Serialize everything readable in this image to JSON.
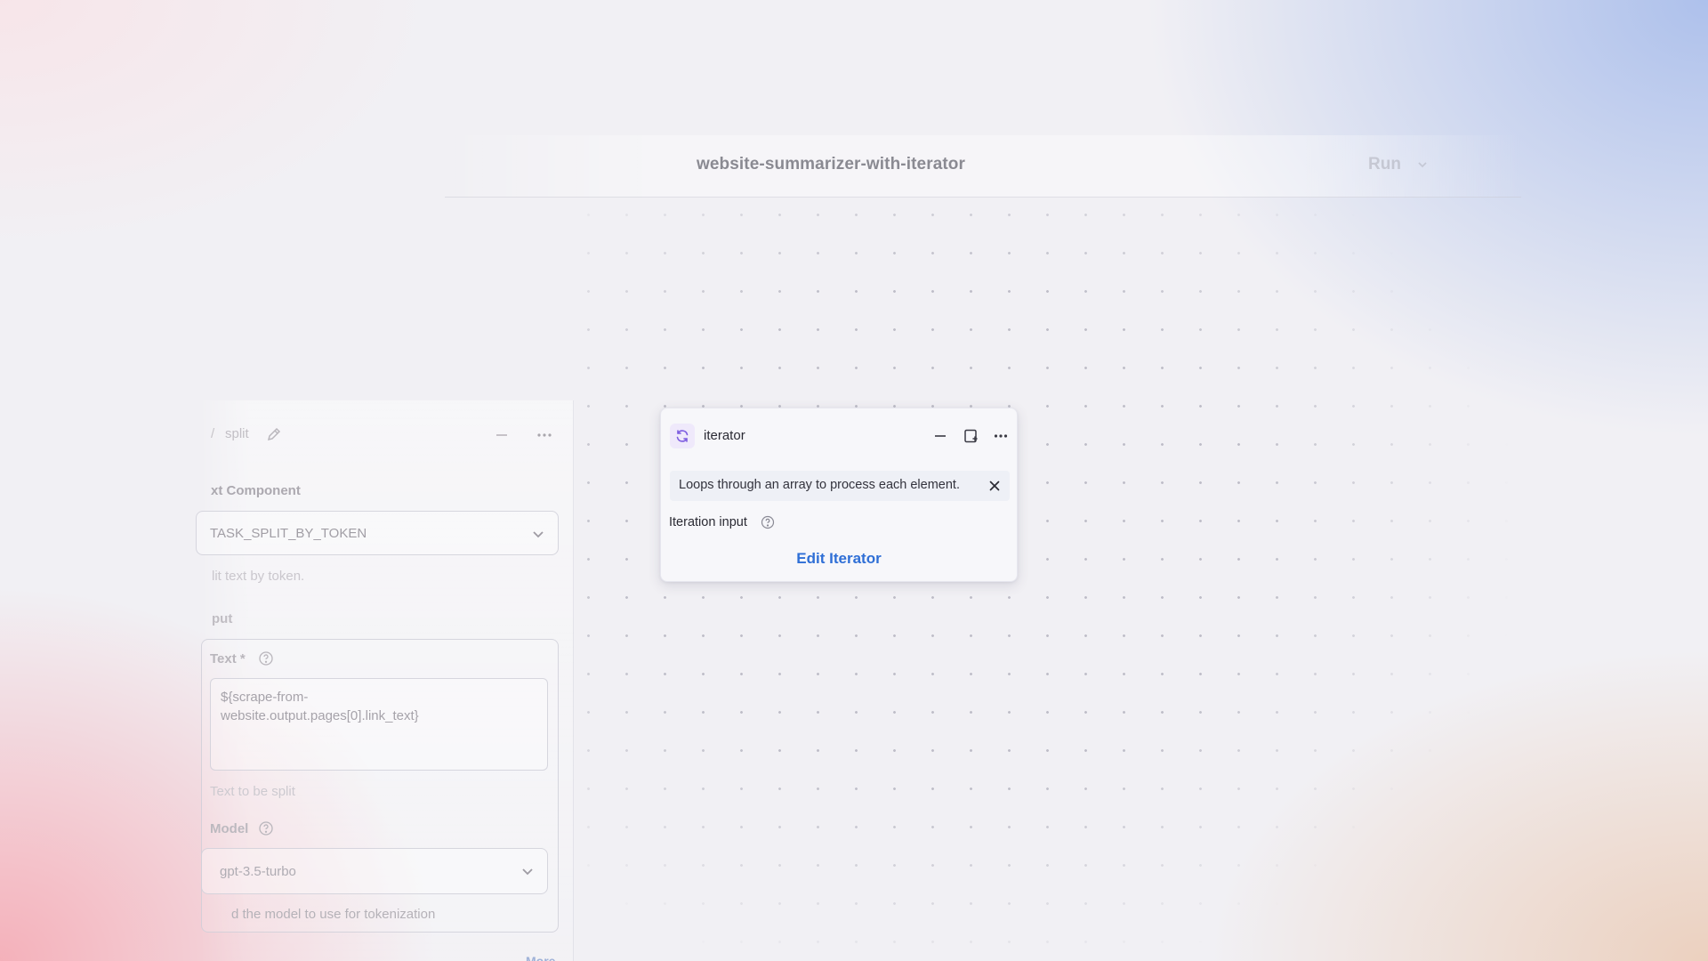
{
  "header": {
    "pipeline_title": "website-summarizer-with-iterator",
    "run_label": "Run"
  },
  "left_panel": {
    "node_title": "split",
    "component_label": "xt Component",
    "task_value": "TASK_SPLIT_BY_TOKEN",
    "task_description": "lit text by token.",
    "input_section": "put",
    "text_field_label": "Text *",
    "text_field_value": "${scrape-from-\nwebsite.output.pages[0].link_text}",
    "text_field_hint": "Text to be split",
    "model_label": "Model",
    "model_value": "gpt-3.5-turbo",
    "model_hint": "d the model to use for tokenization",
    "more_label": "More"
  },
  "iterator_node": {
    "title": "iterator",
    "info_text": "Loops through an array to process each element.",
    "iteration_input_label": "Iteration input",
    "edit_button_label": "Edit Iterator"
  },
  "colors": {
    "accent": "#2f6fd6",
    "node_icon_bg": "#efe9fb",
    "node_icon": "#7c5ce0"
  },
  "icons": {
    "iterator_node": "loop-icon",
    "minimize": "minus-icon",
    "expand": "expand-icon",
    "more": "ellipsis-icon",
    "close": "close-icon",
    "help": "help-circle-icon",
    "edit_name": "pencil-icon",
    "dropdown": "chevron-down-icon"
  }
}
